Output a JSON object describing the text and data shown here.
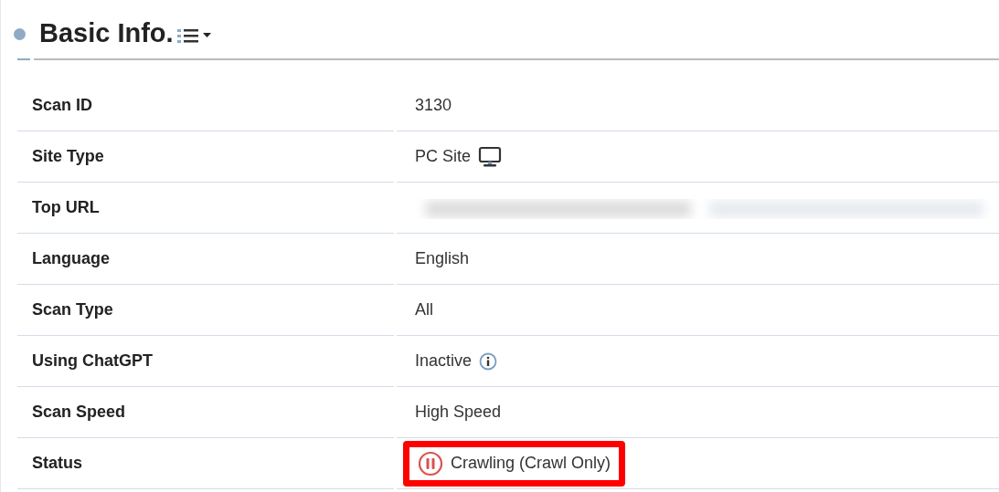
{
  "heading": {
    "title": "Basic Info."
  },
  "rows": [
    {
      "label": "Scan ID",
      "kind": "text",
      "value": "3130"
    },
    {
      "label": "Site Type",
      "kind": "monitor",
      "value": "PC Site"
    },
    {
      "label": "Top URL",
      "kind": "blurred"
    },
    {
      "label": "Language",
      "kind": "text",
      "value": "English"
    },
    {
      "label": "Scan Type",
      "kind": "text",
      "value": "All"
    },
    {
      "label": "Using ChatGPT",
      "kind": "info",
      "value": "Inactive"
    },
    {
      "label": "Scan Speed",
      "kind": "text",
      "value": "High Speed"
    },
    {
      "label": "Status",
      "kind": "status",
      "value": "Crawling (Crawl Only)",
      "highlighted": true
    }
  ]
}
